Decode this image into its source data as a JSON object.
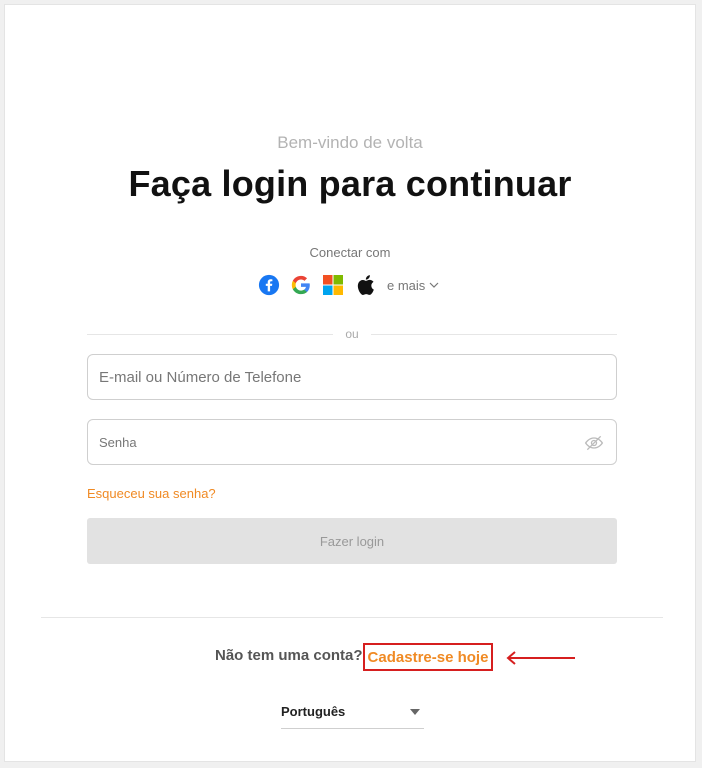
{
  "header": {
    "welcome": "Bem-vindo de volta",
    "title": "Faça login para continuar"
  },
  "social": {
    "label": "Conectar com",
    "icons": [
      "facebook-icon",
      "google-icon",
      "microsoft-icon",
      "apple-icon"
    ],
    "more_label": "e mais"
  },
  "divider": {
    "label": "ou"
  },
  "form": {
    "email_placeholder": "E-mail ou Número de Telefone",
    "email_value": "",
    "password_placeholder": "Senha",
    "password_value": "",
    "forgot_label": "Esqueceu sua senha?",
    "login_label": "Fazer login"
  },
  "footer": {
    "no_account": "Não tem uma conta?",
    "signup_label": "Cadastre-se hoje",
    "language": "Português"
  },
  "colors": {
    "accent": "#f08a24",
    "highlight_box": "#d61f1f",
    "button_disabled": "#e2e2e2"
  }
}
